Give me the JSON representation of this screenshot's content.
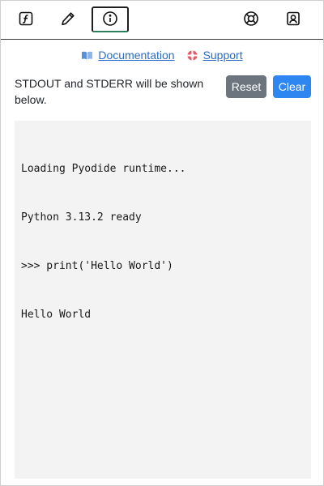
{
  "toolbar": {
    "buttons": [
      {
        "name": "function-icon",
        "active": false
      },
      {
        "name": "pencil-icon",
        "active": false
      },
      {
        "name": "info-icon",
        "active": true
      },
      {
        "name": "lifebuoy-icon",
        "active": false
      },
      {
        "name": "contact-icon",
        "active": false
      }
    ]
  },
  "links": {
    "documentation": {
      "icon": "book-icon",
      "label": "Documentation"
    },
    "support": {
      "icon": "lifebuoy-icon",
      "label": "Support"
    }
  },
  "info": {
    "text": "STDOUT and STDERR will be shown below."
  },
  "actions": {
    "reset_label": "Reset",
    "clear_label": "Clear"
  },
  "console": {
    "lines": [
      "Loading Pyodide runtime...",
      "Python 3.13.2 ready",
      ">>> print('Hello World')",
      "Hello World"
    ]
  },
  "colors": {
    "link": "#2b6cc4",
    "reset_button": "#6c757d",
    "clear_button": "#2e86f0",
    "console_bg": "#f3f3f3"
  }
}
